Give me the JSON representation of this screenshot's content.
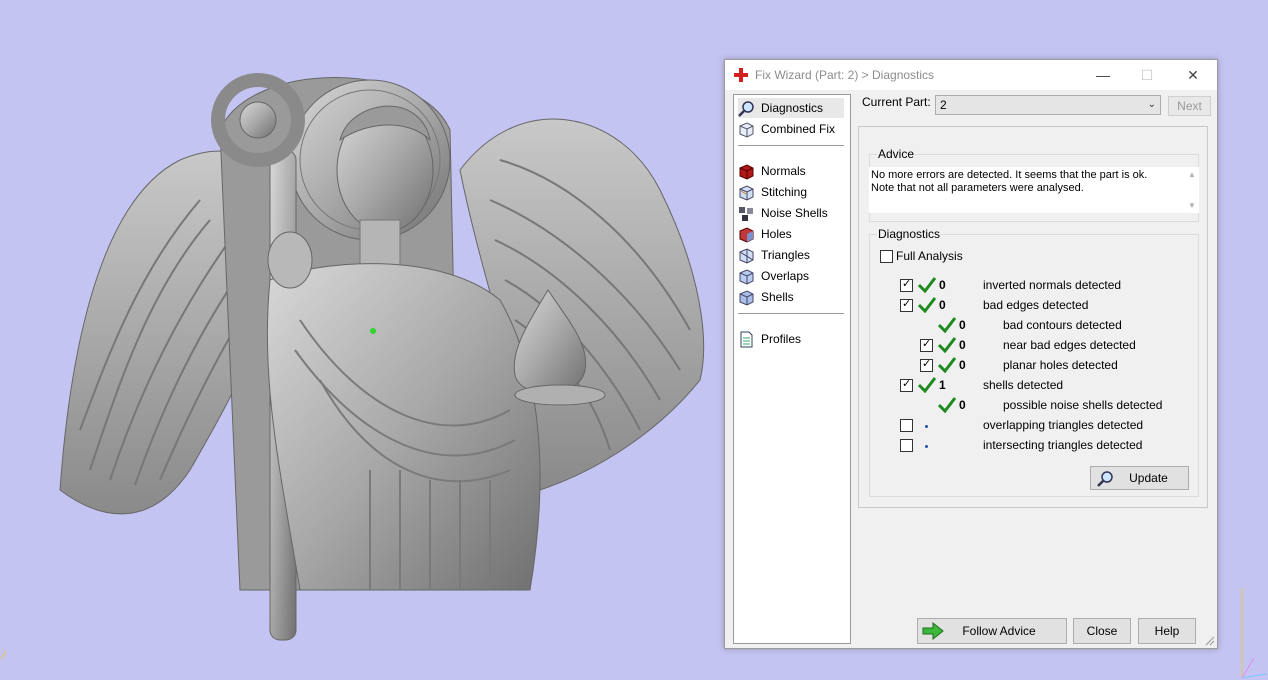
{
  "colors": {
    "viewport_bg": "#c4c4f2",
    "model": "#a9a9a9",
    "check_green": "#1e8a1e",
    "title_icon_red": "#d42020"
  },
  "window": {
    "title": "Fix Wizard (Part: 2) > Diagnostics",
    "minimize_label": "—",
    "maximize_label": "☐",
    "close_label": "✕"
  },
  "nav": {
    "items": [
      {
        "label": "Diagnostics",
        "icon": "magnifier-icon",
        "selected": true
      },
      {
        "label": "Combined Fix",
        "icon": "cube-fix-icon"
      },
      {
        "label": "Normals",
        "icon": "normals-cube-icon"
      },
      {
        "label": "Stitching",
        "icon": "stitching-cube-icon"
      },
      {
        "label": "Noise Shells",
        "icon": "noise-shells-icon"
      },
      {
        "label": "Holes",
        "icon": "holes-cube-icon"
      },
      {
        "label": "Triangles",
        "icon": "triangles-cube-icon"
      },
      {
        "label": "Overlaps",
        "icon": "overlaps-cube-icon"
      },
      {
        "label": "Shells",
        "icon": "shells-cube-icon"
      },
      {
        "label": "Profiles",
        "icon": "document-icon"
      }
    ]
  },
  "current_part": {
    "label": "Current Part:",
    "value": "2",
    "next_label": "Next"
  },
  "advice": {
    "title": "Advice",
    "line1": "No more errors are detected. It seems that the part is ok.",
    "line2": "Note that not all parameters were analysed."
  },
  "diagnostics": {
    "title": "Diagnostics",
    "full_analysis_label": "Full Analysis",
    "full_analysis_checked": false,
    "rows": [
      {
        "checkbox": true,
        "checked": true,
        "status": "check",
        "count": "0",
        "label": "inverted normals detected"
      },
      {
        "checkbox": true,
        "checked": true,
        "status": "check",
        "count": "0",
        "label": "bad edges detected"
      },
      {
        "checkbox": false,
        "checked": false,
        "status": "check",
        "count": "0",
        "label": "bad contours detected"
      },
      {
        "checkbox": true,
        "checked": true,
        "status": "check",
        "count": "0",
        "label": "near bad edges detected"
      },
      {
        "checkbox": true,
        "checked": true,
        "status": "check",
        "count": "0",
        "label": "planar holes detected"
      },
      {
        "checkbox": true,
        "checked": true,
        "status": "check",
        "count": "1",
        "label": "shells detected"
      },
      {
        "checkbox": false,
        "checked": false,
        "status": "check",
        "count": "0",
        "label": "possible noise shells detected"
      },
      {
        "checkbox": true,
        "checked": false,
        "status": "dot",
        "count": "",
        "label": "overlapping triangles detected"
      },
      {
        "checkbox": true,
        "checked": false,
        "status": "dot",
        "count": "",
        "label": "intersecting triangles detected"
      }
    ],
    "update_label": "Update"
  },
  "footer": {
    "follow_advice_label": "Follow Advice",
    "close_label": "Close",
    "help_label": "Help"
  }
}
